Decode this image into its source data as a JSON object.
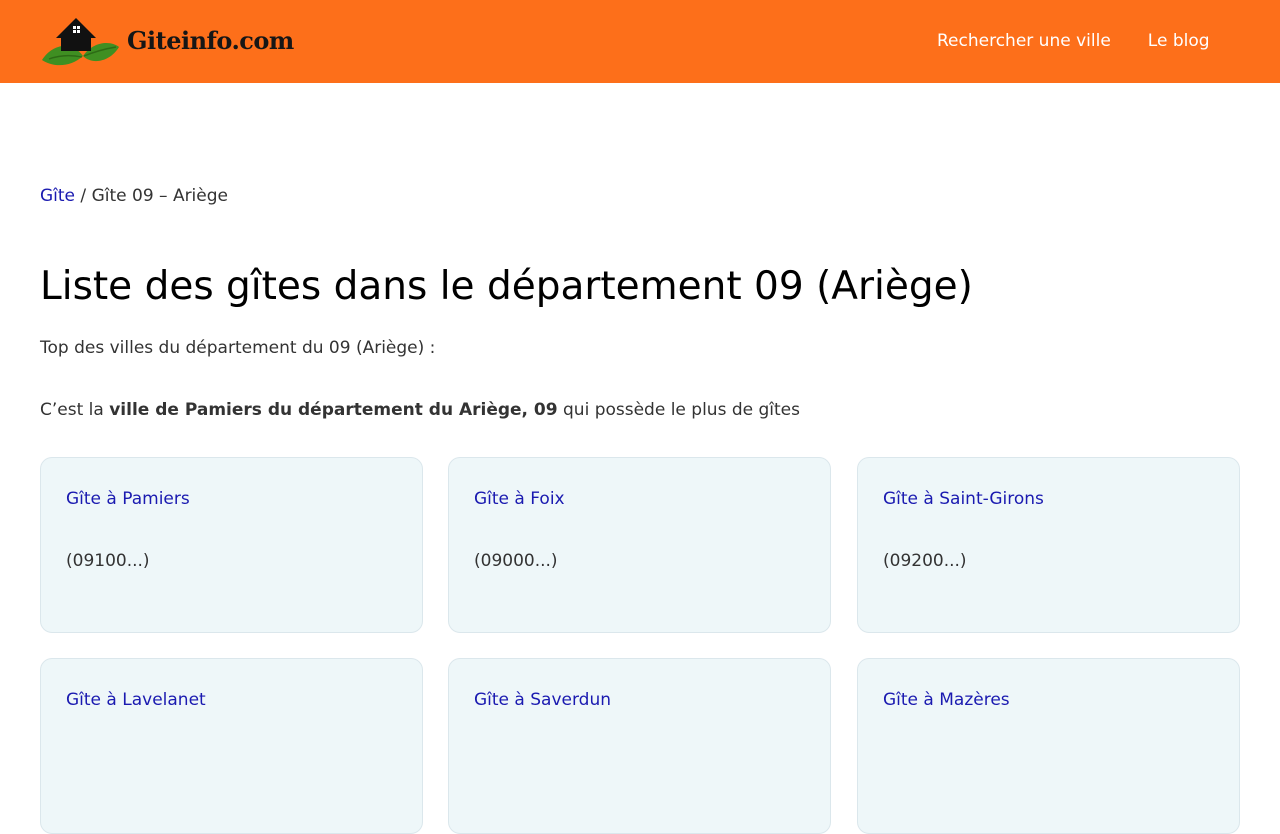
{
  "site": {
    "logo_text": "Giteinfo.com"
  },
  "nav": {
    "items": [
      "Rechercher une ville",
      "Le blog"
    ]
  },
  "breadcrumb": {
    "home": "Gîte",
    "separator": " / ",
    "current": "Gîte 09 – Ariège"
  },
  "main": {
    "title": "Liste des gîtes dans le département 09 (Ariège)",
    "subtitle": "Top des villes du département du 09 (Ariège) :",
    "summary": {
      "prefix": "C’est la ",
      "bold": "ville de Pamiers  du département du Ariège, 09",
      "suffix": " qui possède le plus de gîtes"
    },
    "cards": [
      {
        "title": "Gîte à Pamiers",
        "postal": "(09100...)"
      },
      {
        "title": "Gîte à Foix",
        "postal": "(09000...)"
      },
      {
        "title": "Gîte à Saint-Girons",
        "postal": "(09200...)"
      },
      {
        "title": "Gîte à Lavelanet",
        "postal": ""
      },
      {
        "title": "Gîte à Saverdun",
        "postal": ""
      },
      {
        "title": "Gîte à Mazères",
        "postal": ""
      }
    ]
  },
  "colors": {
    "header": "#fd6f1a",
    "link": "#1a1ab0",
    "card_background": "#eef7f9"
  },
  "icons": {
    "logo": "house-leaves-icon"
  }
}
